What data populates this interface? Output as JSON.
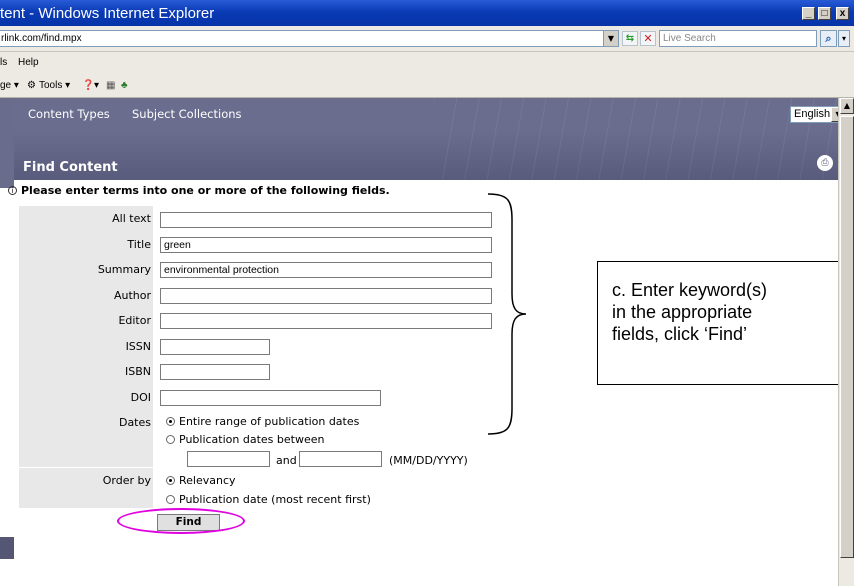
{
  "window": {
    "title": "tent - Windows Internet Explorer",
    "minimize": "_",
    "maximize": "□",
    "close": "x"
  },
  "address": {
    "url": "rlink.com/find.mpx",
    "search_placeholder": "Live Search"
  },
  "menu": {
    "items": [
      "ls",
      "Help"
    ]
  },
  "cmdbar": {
    "page": "ge ▾",
    "tools": "Tools ▾",
    "help": "▾"
  },
  "site_nav": {
    "links": [
      "Content Types",
      "Subject Collections"
    ],
    "language": "English"
  },
  "find": {
    "heading": "Find Content",
    "instruction": "Please enter terms into one or more of the following fields.",
    "fields": {
      "all_text": {
        "label": "All text",
        "value": ""
      },
      "title": {
        "label": "Title",
        "value": "green"
      },
      "summary": {
        "label": "Summary",
        "value": "environmental protection"
      },
      "author": {
        "label": "Author",
        "value": ""
      },
      "editor": {
        "label": "Editor",
        "value": ""
      },
      "issn": {
        "label": "ISSN",
        "value": ""
      },
      "isbn": {
        "label": "ISBN",
        "value": ""
      },
      "doi": {
        "label": "DOI",
        "value": ""
      }
    },
    "dates": {
      "label": "Dates",
      "option_all": "Entire range of publication dates",
      "option_between": "Publication dates between",
      "and_label": "and",
      "format_hint": "(MM/DD/YYYY)"
    },
    "order_by": {
      "label": "Order by",
      "option_relevancy": "Relevancy",
      "option_date": "Publication date (most recent first)"
    },
    "submit": "Find"
  },
  "callout": {
    "line1": "c. Enter keyword(s)",
    "line2": "in the appropriate",
    "line3": "fields, click ‘Find’"
  },
  "colors": {
    "nav_band": "#6b6d8f",
    "label_column": "#e8e8e8",
    "highlight_ellipse": "#e000e0",
    "title_bar": "#0a3bb5"
  }
}
